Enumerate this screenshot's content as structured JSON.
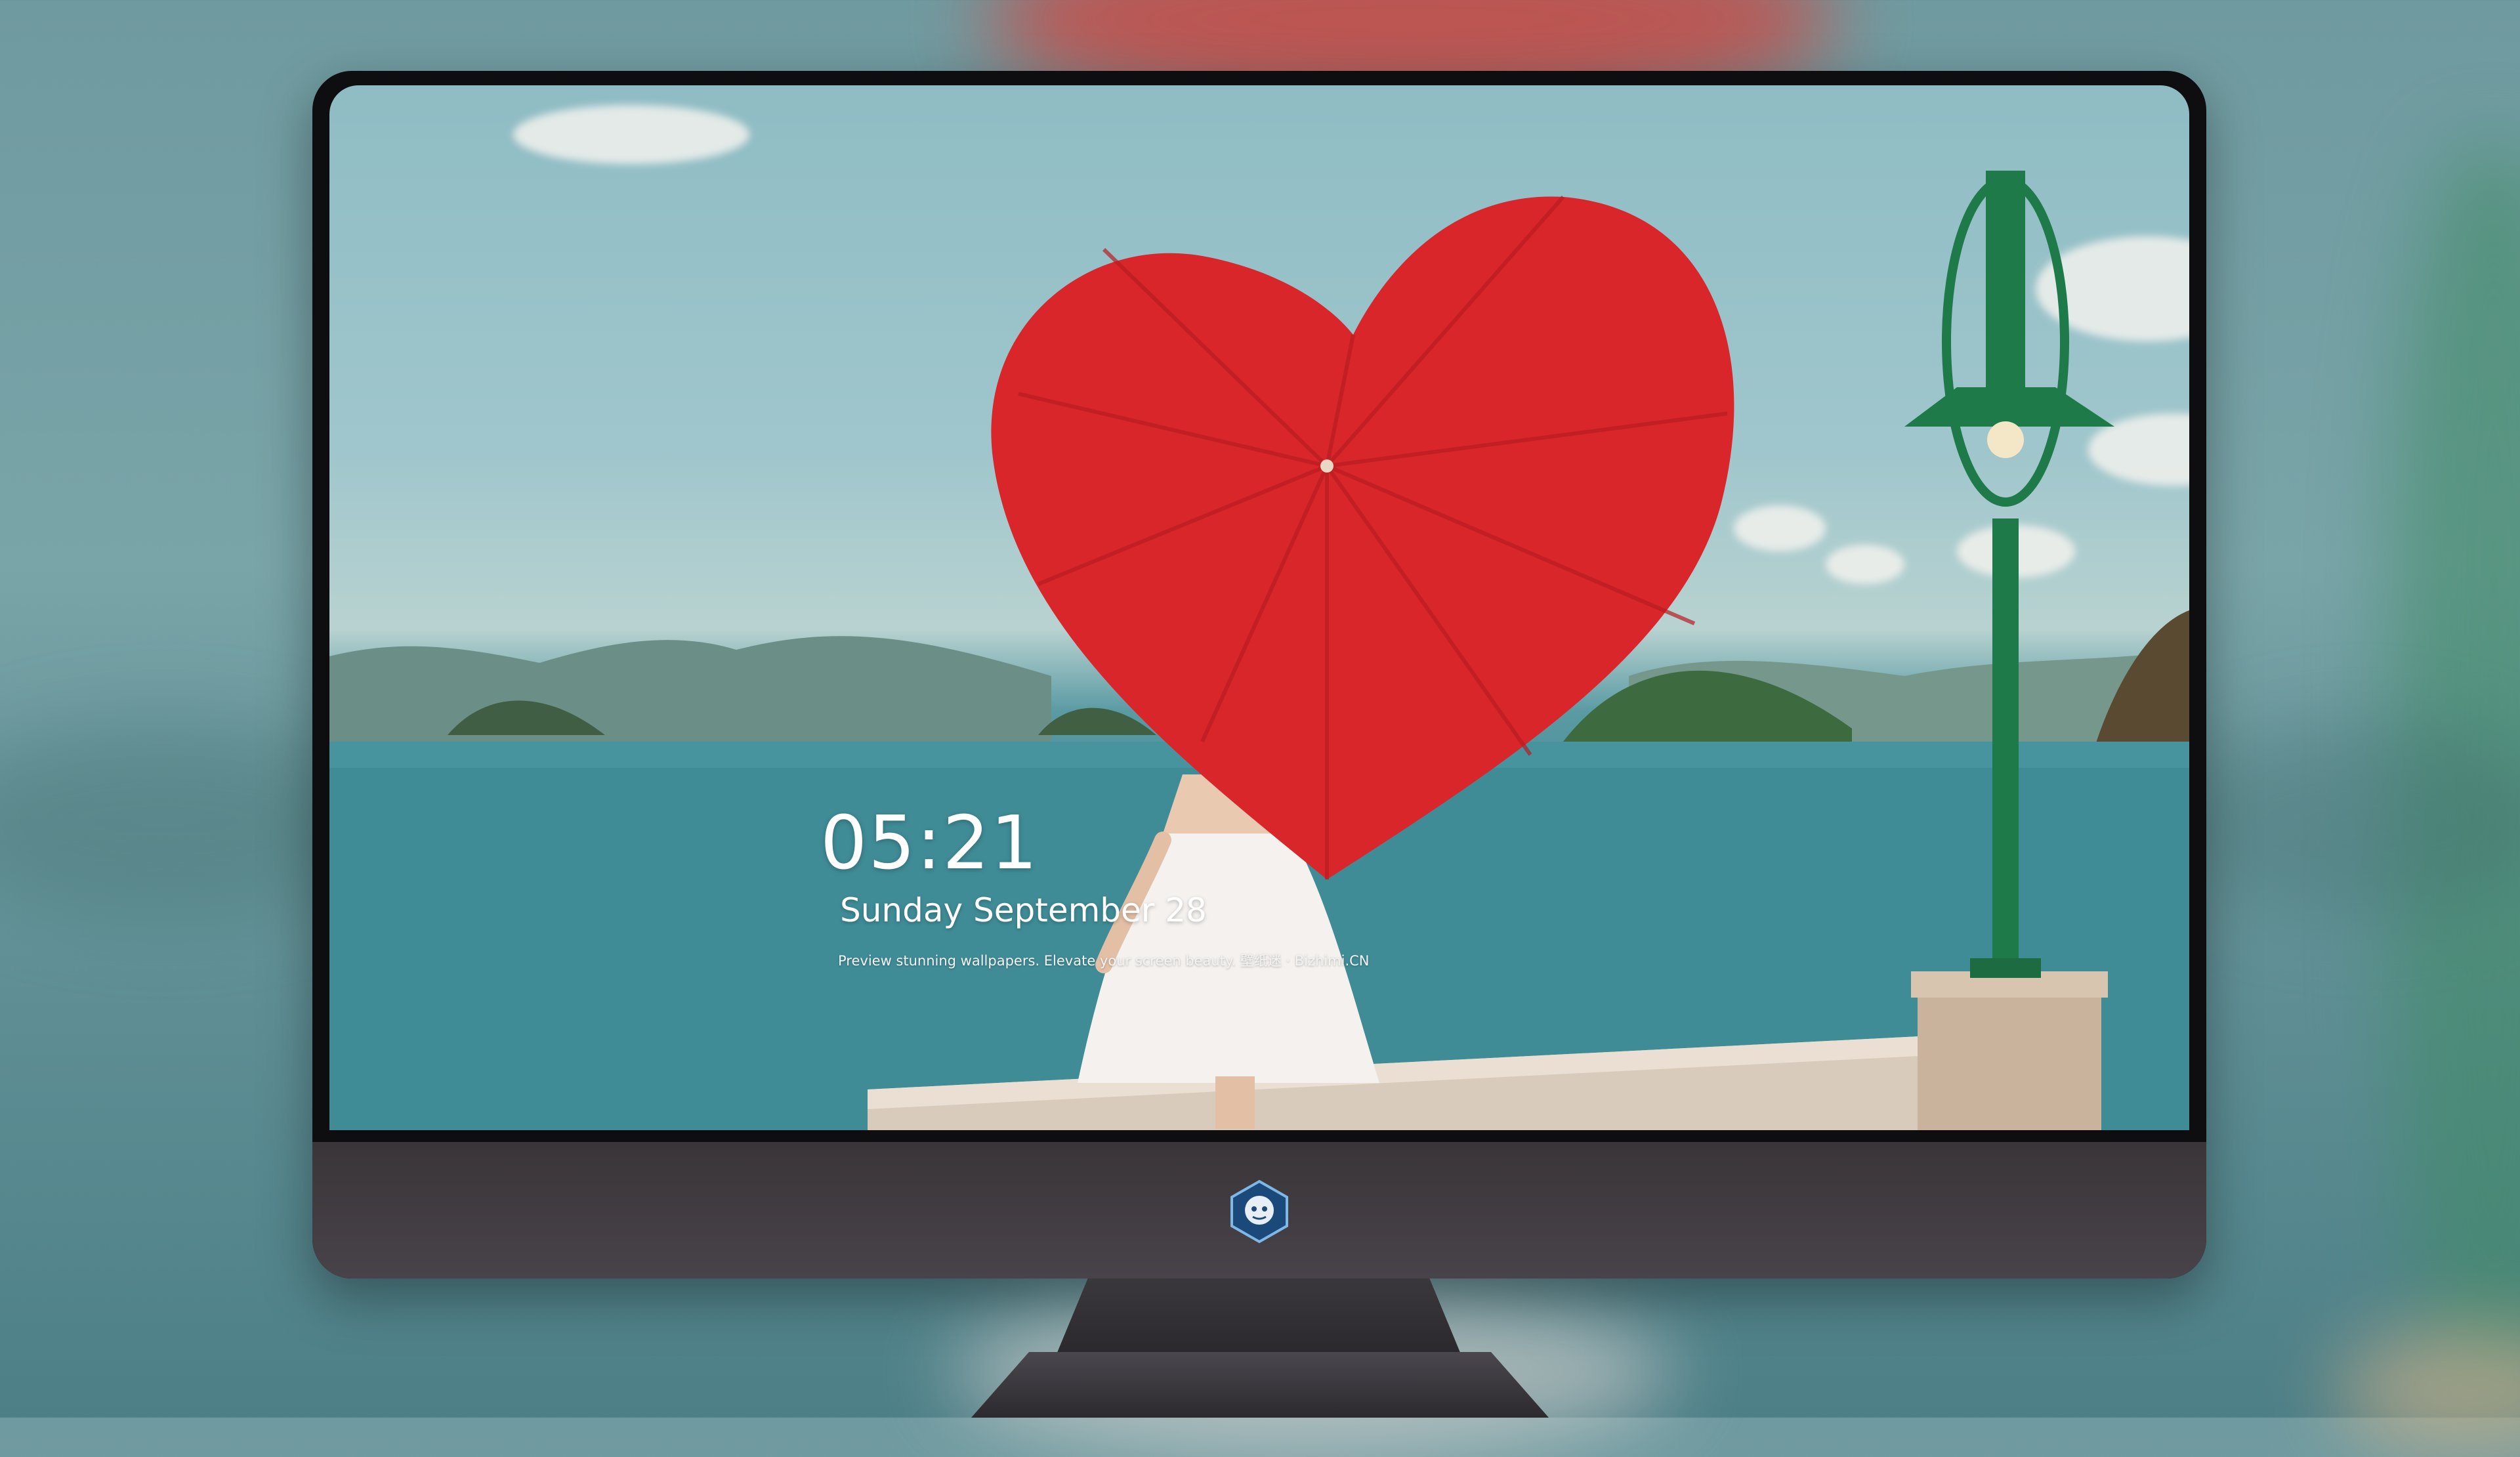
{
  "lock_screen": {
    "time": "05:21",
    "date": "Sunday September  28",
    "tagline": "Preview stunning wallpapers. Elevate your screen beauty. 壁纸迷 · Bizhimi.CN"
  },
  "dock": {
    "apps": [
      {
        "name": "messages-icon",
        "color": "#34c759"
      },
      {
        "name": "weather-icon",
        "color": "#2f8df3"
      },
      {
        "name": "clock-icon",
        "color": "#1c1c1e"
      },
      {
        "name": "preview-icon",
        "color": "#f2f2f2"
      },
      {
        "name": "video-editor-icon",
        "color": "#5ac8fa"
      },
      {
        "name": "notes-icon",
        "color": "#ffd60a"
      },
      {
        "name": "photo-booth-icon",
        "color": "#f2f2f2"
      }
    ],
    "apps_after_separator": [
      {
        "name": "music-icon",
        "color": "#e84fd1"
      },
      {
        "name": "app-store-icon",
        "color": "#1e8cf0"
      },
      {
        "name": "camera-icon",
        "color": "#5b5b5e"
      }
    ]
  },
  "colors": {
    "umbrella": "#d8262b",
    "lamp_post": "#1f7a4a",
    "monitor_chin": "#403b40"
  }
}
